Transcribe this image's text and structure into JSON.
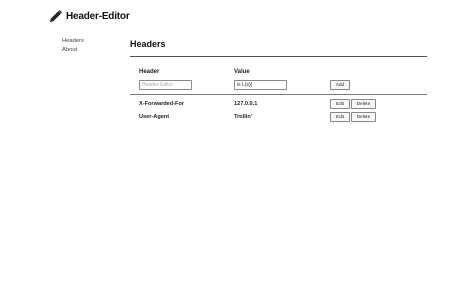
{
  "app": {
    "title": "Header-Editor",
    "logo_icon": "pencil-icon"
  },
  "sidebar": {
    "items": [
      {
        "label": "Headers"
      },
      {
        "label": "About"
      }
    ]
  },
  "main": {
    "title": "Headers",
    "form": {
      "header_label": "Header",
      "value_label": "Value",
      "header_placeholder": "Header-Editor",
      "value_value": "is L(s)(",
      "add_label": "Add"
    },
    "rows": [
      {
        "name": "X-Forwarded-For",
        "value": "127.0.0.1",
        "edit_label": "Edit",
        "delete_label": "Delete"
      },
      {
        "name": "User-Agent",
        "value": "Trollin'",
        "edit_label": "Edit",
        "delete_label": "Delete"
      }
    ]
  }
}
